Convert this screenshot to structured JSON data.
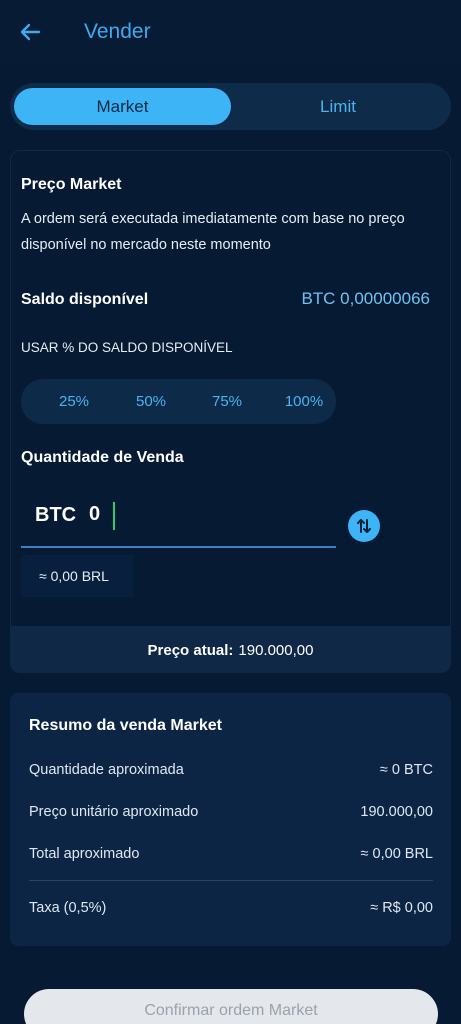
{
  "header": {
    "title": "Vender",
    "back_icon": "arrow-left-icon"
  },
  "tabs": [
    {
      "label": "Market",
      "active": true
    },
    {
      "label": "Limit",
      "active": false
    }
  ],
  "market_info": {
    "title": "Preço Market",
    "description_line1": "A ordem será executada imediatamente com base no preço",
    "description_line2": "disponível no mercado neste momento"
  },
  "balance": {
    "label": "Saldo disponível",
    "value": "BTC 0,00000066"
  },
  "usage": {
    "label": "USAR % DO SALDO DISPONÍVEL",
    "options": [
      "25%",
      "50%",
      "75%",
      "100%"
    ]
  },
  "sell_amount": {
    "label": "Quantidade de Venda",
    "currency": "BTC",
    "value": "0",
    "approx": "≈ 0,00 BRL",
    "swap_icon": "swap-vertical-icon"
  },
  "current_price": {
    "label": "Preço atual:",
    "value": "190.000,00"
  },
  "summary": {
    "title": "Resumo da venda Market",
    "rows": [
      {
        "label": "Quantidade aproximada",
        "value": "≈ 0 BTC"
      },
      {
        "label": "Preço unitário aproximado",
        "value": "190.000,00"
      },
      {
        "label": "Total aproximado",
        "value": "≈ 0,00 BRL"
      }
    ],
    "fee": {
      "label": "Taxa (0,5%)",
      "value": "≈ R$ 0,00"
    }
  },
  "confirm_button": "Confirmar ordem Market",
  "colors": {
    "background": "#061a33",
    "accent": "#3db4f5",
    "accent_text": "#41a9ee",
    "card": "#0c2544"
  }
}
